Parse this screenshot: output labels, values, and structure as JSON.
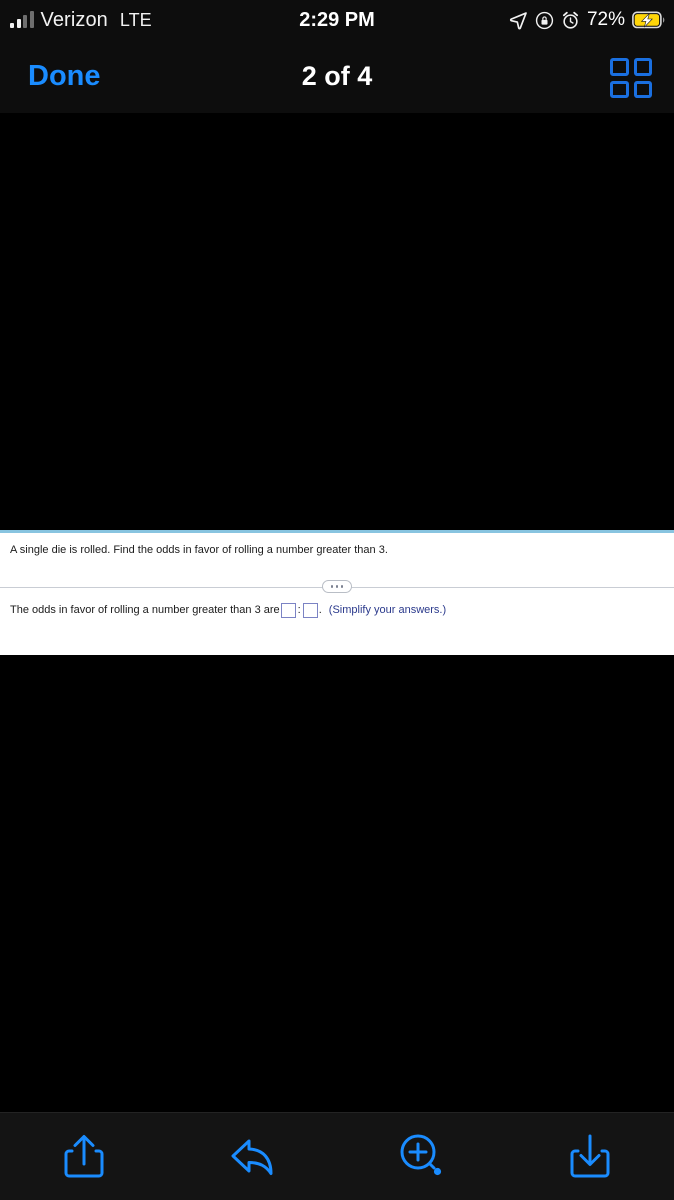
{
  "status_bar": {
    "carrier": "Verizon",
    "network_mode": "LTE",
    "time": "2:29 PM",
    "battery_percent": "72%",
    "icons": {
      "signal": "signal-bars-icon",
      "location": "location-arrow-icon",
      "rotation_lock": "rotation-lock-icon",
      "alarm": "alarm-clock-icon",
      "battery": "battery-charging-icon"
    },
    "colors": {
      "battery_fill": "#ffd60a",
      "text": "#f2f2f2"
    }
  },
  "nav_bar": {
    "done_label": "Done",
    "title": "2 of 4",
    "grid_button_name": "grid-view-button",
    "accent_color": "#1a8cff"
  },
  "document": {
    "question": "A single die is rolled. Find the odds in favor of rolling a number greater than 3.",
    "divider_icon": "ellipsis-pill-icon",
    "answer_prefix": "The odds in favor of rolling a number greater than 3 are",
    "answer_box_1": "",
    "answer_box_2": "",
    "answer_separator": ":",
    "answer_period": ".",
    "answer_hint": "(Simplify your answers.)",
    "top_border_color": "#88c4e0",
    "hint_color": "#2b3a8c",
    "input_border_color": "#7b83c4"
  },
  "toolbar": {
    "accent_color": "#1a8cff",
    "buttons": [
      {
        "name": "share-button",
        "icon": "share-icon",
        "label": "Share"
      },
      {
        "name": "reply-button",
        "icon": "reply-arrow-icon",
        "label": "Reply"
      },
      {
        "name": "zoom-in-button",
        "icon": "magnifier-plus-icon",
        "label": "Zoom In"
      },
      {
        "name": "download-button",
        "icon": "download-icon",
        "label": "Download"
      }
    ]
  }
}
